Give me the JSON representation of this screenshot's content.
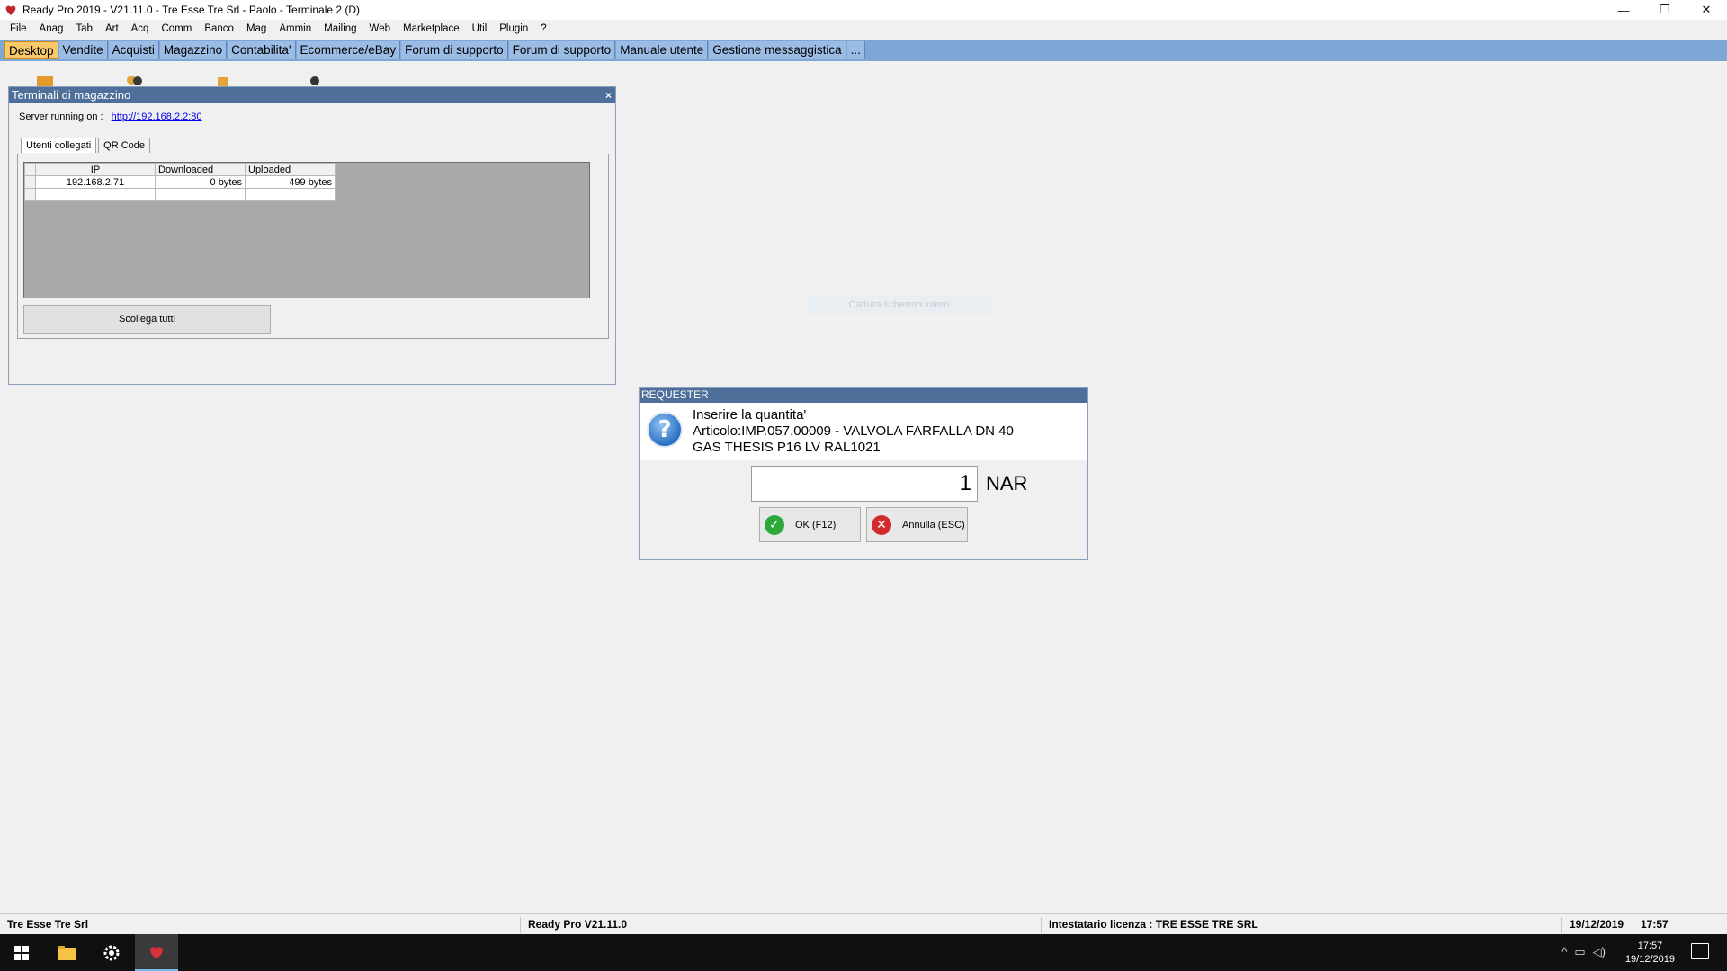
{
  "window": {
    "title": "Ready Pro 2019 - V21.11.0 - Tre Esse Tre Srl - Paolo - Terminale 2 (D)",
    "min_glyph": "—",
    "restore_glyph": "❐",
    "close_glyph": "✕"
  },
  "menu": [
    "File",
    "Anag",
    "Tab",
    "Art",
    "Acq",
    "Comm",
    "Banco",
    "Mag",
    "Ammin",
    "Mailing",
    "Web",
    "Marketplace",
    "Util",
    "Plugin",
    "?"
  ],
  "tabs": [
    {
      "label": "Desktop",
      "active": true
    },
    {
      "label": "Vendite",
      "active": false
    },
    {
      "label": "Acquisti",
      "active": false
    },
    {
      "label": "Magazzino",
      "active": false
    },
    {
      "label": "Contabilita'",
      "active": false
    },
    {
      "label": "Ecommerce/eBay",
      "active": false
    },
    {
      "label": "Forum di supporto",
      "active": false
    },
    {
      "label": "Forum di supporto",
      "active": false
    },
    {
      "label": "Manuale utente",
      "active": false
    },
    {
      "label": "Gestione messaggistica",
      "active": false
    },
    {
      "label": "...",
      "active": false
    }
  ],
  "terminal_window": {
    "title": "Terminali di magazzino",
    "close_glyph": "×",
    "server_label": "Server running on :",
    "server_url": "http://192.168.2.2:80",
    "tabs": [
      "Utenti collegati",
      "QR Code"
    ],
    "columns": [
      "IP",
      "Downloaded",
      "Uploaded"
    ],
    "rows": [
      {
        "ip": "192.168.2.71",
        "downloaded": "0 bytes",
        "uploaded": "499 bytes"
      }
    ],
    "disconnect_button": "Scollega tutti"
  },
  "faint_label": "Cattura schermo intero",
  "requester": {
    "title": "REQUESTER",
    "icon_glyph": "?",
    "message_line1": "Inserire la quantita'",
    "message_line2": "Articolo:IMP.057.00009 - VALVOLA FARFALLA DN 40",
    "message_line3": "GAS THESIS P16 LV RAL1021",
    "quantity": "1",
    "unit": "NAR",
    "ok_label": "OK (F12)",
    "ok_glyph": "✓",
    "cancel_label": "Annulla (ESC)",
    "cancel_glyph": "✕"
  },
  "statusbar": {
    "company": "Tre Esse Tre Srl",
    "version": "Ready Pro V21.11.0",
    "license": "Intestatario licenza : TRE ESSE TRE SRL",
    "date": "19/12/2019",
    "time": "17:57"
  },
  "taskbar": {
    "clock_time": "17:57",
    "clock_date": "19/12/2019",
    "tray_up_glyph": "^",
    "tray_net_glyph": "▭",
    "tray_volume_glyph": "◁)"
  }
}
